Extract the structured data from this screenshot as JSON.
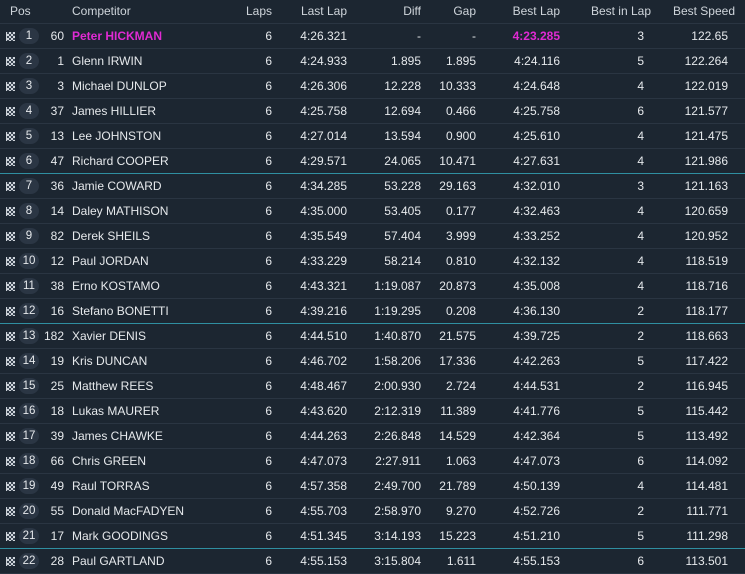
{
  "headers": {
    "pos": "Pos",
    "competitor": "Competitor",
    "laps": "Laps",
    "last_lap": "Last Lap",
    "diff": "Diff",
    "gap": "Gap",
    "best_lap": "Best Lap",
    "best_in_lap": "Best in Lap",
    "best_speed": "Best Speed"
  },
  "colors": {
    "highlight": "#e02ad3",
    "group_separator": "#2f8fa1",
    "background": "#1c2631"
  },
  "rows": [
    {
      "pos": "1",
      "num": "60",
      "name": "Peter HICKMAN",
      "laps": "6",
      "last": "4:26.321",
      "diff": "-",
      "gap": "-",
      "best": "4:23.285",
      "bestin": "3",
      "speed": "122.65"
    },
    {
      "pos": "2",
      "num": "1",
      "name": "Glenn IRWIN",
      "laps": "6",
      "last": "4:24.933",
      "diff": "1.895",
      "gap": "1.895",
      "best": "4:24.116",
      "bestin": "5",
      "speed": "122.264"
    },
    {
      "pos": "3",
      "num": "3",
      "name": "Michael DUNLOP",
      "laps": "6",
      "last": "4:26.306",
      "diff": "12.228",
      "gap": "10.333",
      "best": "4:24.648",
      "bestin": "4",
      "speed": "122.019"
    },
    {
      "pos": "4",
      "num": "37",
      "name": "James HILLIER",
      "laps": "6",
      "last": "4:25.758",
      "diff": "12.694",
      "gap": "0.466",
      "best": "4:25.758",
      "bestin": "6",
      "speed": "121.577"
    },
    {
      "pos": "5",
      "num": "13",
      "name": "Lee JOHNSTON",
      "laps": "6",
      "last": "4:27.014",
      "diff": "13.594",
      "gap": "0.900",
      "best": "4:25.610",
      "bestin": "4",
      "speed": "121.475"
    },
    {
      "pos": "6",
      "num": "47",
      "name": "Richard COOPER",
      "laps": "6",
      "last": "4:29.571",
      "diff": "24.065",
      "gap": "10.471",
      "best": "4:27.631",
      "bestin": "4",
      "speed": "121.986"
    },
    {
      "pos": "7",
      "num": "36",
      "name": "Jamie COWARD",
      "laps": "6",
      "last": "4:34.285",
      "diff": "53.228",
      "gap": "29.163",
      "best": "4:32.010",
      "bestin": "3",
      "speed": "121.163"
    },
    {
      "pos": "8",
      "num": "14",
      "name": "Daley MATHISON",
      "laps": "6",
      "last": "4:35.000",
      "diff": "53.405",
      "gap": "0.177",
      "best": "4:32.463",
      "bestin": "4",
      "speed": "120.659"
    },
    {
      "pos": "9",
      "num": "82",
      "name": "Derek SHEILS",
      "laps": "6",
      "last": "4:35.549",
      "diff": "57.404",
      "gap": "3.999",
      "best": "4:33.252",
      "bestin": "4",
      "speed": "120.952"
    },
    {
      "pos": "10",
      "num": "12",
      "name": "Paul JORDAN",
      "laps": "6",
      "last": "4:33.229",
      "diff": "58.214",
      "gap": "0.810",
      "best": "4:32.132",
      "bestin": "4",
      "speed": "118.519"
    },
    {
      "pos": "11",
      "num": "38",
      "name": "Erno KOSTAMO",
      "laps": "6",
      "last": "4:43.321",
      "diff": "1:19.087",
      "gap": "20.873",
      "best": "4:35.008",
      "bestin": "4",
      "speed": "118.716"
    },
    {
      "pos": "12",
      "num": "16",
      "name": "Stefano BONETTI",
      "laps": "6",
      "last": "4:39.216",
      "diff": "1:19.295",
      "gap": "0.208",
      "best": "4:36.130",
      "bestin": "2",
      "speed": "118.177"
    },
    {
      "pos": "13",
      "num": "182",
      "name": "Xavier DENIS",
      "laps": "6",
      "last": "4:44.510",
      "diff": "1:40.870",
      "gap": "21.575",
      "best": "4:39.725",
      "bestin": "2",
      "speed": "118.663"
    },
    {
      "pos": "14",
      "num": "19",
      "name": "Kris DUNCAN",
      "laps": "6",
      "last": "4:46.702",
      "diff": "1:58.206",
      "gap": "17.336",
      "best": "4:42.263",
      "bestin": "5",
      "speed": "117.422"
    },
    {
      "pos": "15",
      "num": "25",
      "name": "Matthew REES",
      "laps": "6",
      "last": "4:48.467",
      "diff": "2:00.930",
      "gap": "2.724",
      "best": "4:44.531",
      "bestin": "2",
      "speed": "116.945"
    },
    {
      "pos": "16",
      "num": "18",
      "name": "Lukas MAURER",
      "laps": "6",
      "last": "4:43.620",
      "diff": "2:12.319",
      "gap": "11.389",
      "best": "4:41.776",
      "bestin": "5",
      "speed": "115.442"
    },
    {
      "pos": "17",
      "num": "39",
      "name": "James CHAWKE",
      "laps": "6",
      "last": "4:44.263",
      "diff": "2:26.848",
      "gap": "14.529",
      "best": "4:42.364",
      "bestin": "5",
      "speed": "113.492"
    },
    {
      "pos": "18",
      "num": "66",
      "name": "Chris GREEN",
      "laps": "6",
      "last": "4:47.073",
      "diff": "2:27.911",
      "gap": "1.063",
      "best": "4:47.073",
      "bestin": "6",
      "speed": "114.092"
    },
    {
      "pos": "19",
      "num": "49",
      "name": "Raul TORRAS",
      "laps": "6",
      "last": "4:57.358",
      "diff": "2:49.700",
      "gap": "21.789",
      "best": "4:50.139",
      "bestin": "4",
      "speed": "114.481"
    },
    {
      "pos": "20",
      "num": "55",
      "name": "Donald MacFADYEN",
      "laps": "6",
      "last": "4:55.703",
      "diff": "2:58.970",
      "gap": "9.270",
      "best": "4:52.726",
      "bestin": "2",
      "speed": "111.771"
    },
    {
      "pos": "21",
      "num": "17",
      "name": "Mark GOODINGS",
      "laps": "6",
      "last": "4:51.345",
      "diff": "3:14.193",
      "gap": "15.223",
      "best": "4:51.210",
      "bestin": "5",
      "speed": "111.298"
    },
    {
      "pos": "22",
      "num": "28",
      "name": "Paul GARTLAND",
      "laps": "6",
      "last": "4:55.153",
      "diff": "3:15.804",
      "gap": "1.611",
      "best": "4:55.153",
      "bestin": "6",
      "speed": "113.501"
    }
  ]
}
